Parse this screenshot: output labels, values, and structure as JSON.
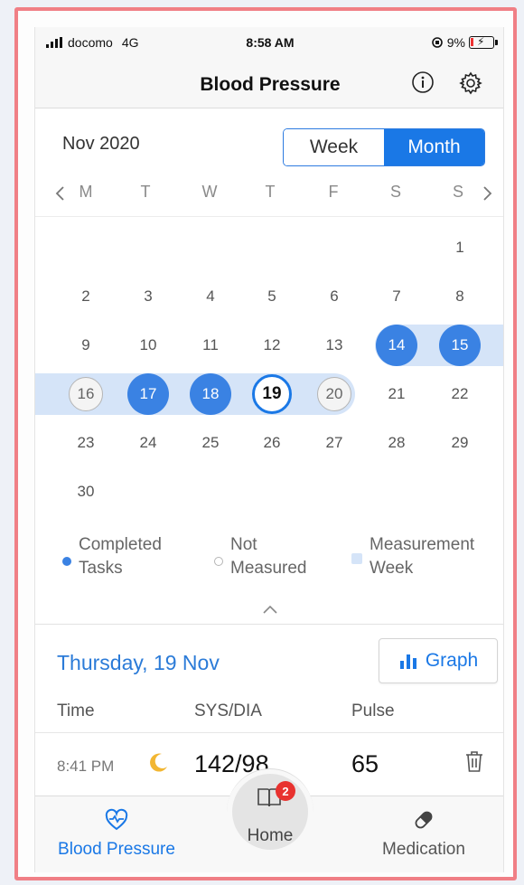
{
  "status_bar": {
    "carrier": "docomo",
    "network": "4G",
    "time": "8:58 AM",
    "battery": "9%"
  },
  "nav": {
    "title": "Blood Pressure"
  },
  "calendar": {
    "month_label": "Nov 2020",
    "view_options": [
      "Week",
      "Month"
    ],
    "selected_view": "Month",
    "weekdays": [
      "M",
      "T",
      "W",
      "T",
      "F",
      "S",
      "S"
    ],
    "weeks": [
      [
        "",
        "",
        "",
        "",
        "",
        "",
        "1"
      ],
      [
        "2",
        "3",
        "4",
        "5",
        "6",
        "7",
        "8"
      ],
      [
        "9",
        "10",
        "11",
        "12",
        "13",
        "14",
        "15"
      ],
      [
        "16",
        "17",
        "18",
        "19",
        "20",
        "21",
        "22"
      ],
      [
        "23",
        "24",
        "25",
        "26",
        "27",
        "28",
        "29"
      ],
      [
        "30",
        "",
        "",
        "",
        "",
        "",
        ""
      ]
    ],
    "completed_days": [
      "14",
      "15",
      "17",
      "18"
    ],
    "not_measured_days": [
      "16",
      "20"
    ],
    "today": "19"
  },
  "legend": {
    "completed": "Completed\nTasks",
    "not_measured": "Not\nMeasured",
    "measurement_week": "Measurement\nWeek"
  },
  "day_detail": {
    "title": "Thursday, 19 Nov",
    "graph_label": "Graph",
    "columns": [
      "Time",
      "SYS/DIA",
      "Pulse"
    ],
    "rows": [
      {
        "time": "8:41 PM",
        "period_icon": "moon-icon",
        "sys_dia": "142/98",
        "pulse": "65"
      }
    ]
  },
  "tab_bar": {
    "blood_pressure": "Blood Pressure",
    "home": "Home",
    "home_badge": "2",
    "medication": "Medication"
  },
  "colors": {
    "accent": "#1a78e6",
    "completed": "#3a82e3",
    "measurement_week": "#d5e4f8",
    "badge": "#e8322f"
  }
}
